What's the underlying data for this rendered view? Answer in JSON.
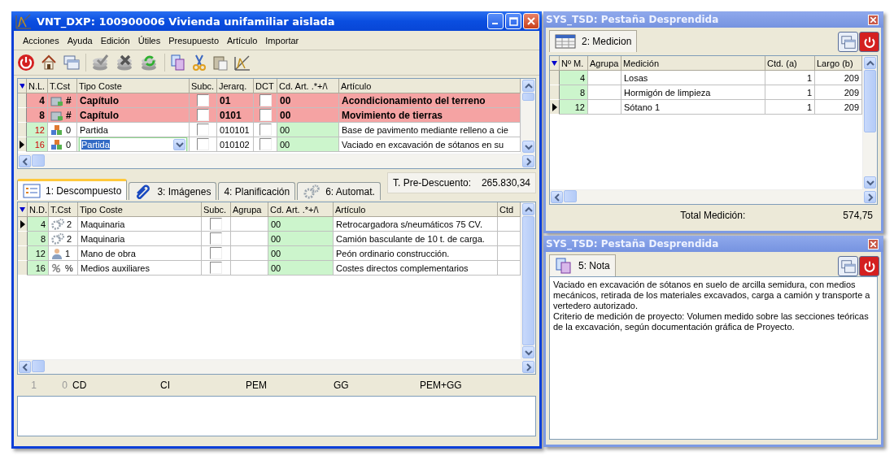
{
  "main_window": {
    "title": "VNT_DXP: 100900006 Vivienda unifamiliar aislada",
    "menu": [
      "Acciones",
      "Ayuda",
      "Edición",
      "Útiles",
      "Presupuesto",
      "Artículo",
      "Importar"
    ],
    "upper_grid": {
      "columns": [
        "N.L.",
        "T.Cst",
        "Tipo Coste",
        "Subc.",
        "Jerarq.",
        "DCT",
        "Cd. Art. .*+/\\",
        "Artículo"
      ],
      "rows": [
        {
          "kind": "chapter",
          "current": false,
          "editing": false,
          "nl": "4",
          "code": "#",
          "tipo": "Capítulo",
          "subc": false,
          "jerarq": "01",
          "dct": false,
          "cd": "00",
          "articulo": "Acondicionamiento del terreno"
        },
        {
          "kind": "chapter",
          "current": false,
          "editing": false,
          "nl": "8",
          "code": "#",
          "tipo": "Capítulo",
          "subc": false,
          "jerarq": "0101",
          "dct": false,
          "cd": "00",
          "articulo": "Movimiento de tierras"
        },
        {
          "kind": "item",
          "current": false,
          "editing": false,
          "nl": "12",
          "code": "0",
          "tipo": "Partida",
          "subc": false,
          "jerarq": "010101",
          "dct": false,
          "cd": "00",
          "articulo": "Base de pavimento mediante relleno a cie"
        },
        {
          "kind": "item",
          "current": true,
          "editing": true,
          "nl": "16",
          "code": "0",
          "tipo": "Partida",
          "subc": false,
          "jerarq": "010102",
          "dct": false,
          "cd": "00",
          "articulo": "Vaciado en excavación de sótanos en su"
        }
      ]
    },
    "tabs": [
      {
        "label": "1: Descompuesto",
        "selected": true
      },
      {
        "label": "3: Imágenes",
        "selected": false
      },
      {
        "label": "4: Planificación",
        "selected": false
      },
      {
        "label": "6: Automat.",
        "selected": false
      }
    ],
    "pre_descuento": {
      "label": "T. Pre-Descuento:",
      "value": "265.830,34"
    },
    "lower_grid": {
      "columns": [
        "N.D.",
        "T.Cst",
        "Tipo Coste",
        "Subc.",
        "Agrupa",
        "Cd. Art. .*+/\\",
        "Artículo",
        "Ctd"
      ],
      "rows": [
        {
          "kind": "machinery",
          "current": true,
          "nd": "4",
          "code": "2",
          "tipo": "Maquinaria",
          "subc": false,
          "cd": "00",
          "articulo": "Retrocargadora s/neumáticos 75 CV."
        },
        {
          "kind": "machinery",
          "current": false,
          "nd": "8",
          "code": "2",
          "tipo": "Maquinaria",
          "subc": false,
          "cd": "00",
          "articulo": "Camión basculante de 10 t. de carga."
        },
        {
          "kind": "labor",
          "current": false,
          "nd": "12",
          "code": "1",
          "tipo": "Mano de obra",
          "subc": false,
          "cd": "00",
          "articulo": "Peón ordinario construcción."
        },
        {
          "kind": "auxiliary",
          "current": false,
          "nd": "16",
          "code": "%",
          "tipo": "Medios auxiliares",
          "subc": false,
          "cd": "00",
          "articulo": "Costes directos complementarios"
        }
      ]
    },
    "summary": {
      "counts": [
        "1",
        "0"
      ],
      "labels": [
        "CD",
        "CI",
        "PEM",
        "GG",
        "PEM+GG"
      ]
    }
  },
  "medicion_panel": {
    "title": "SYS_TSD: Pestaña Desprendida",
    "tab": {
      "label": "2: Medicion",
      "selected": true
    },
    "columns": [
      "Nº M.",
      "Agrupa",
      "Medición",
      "Ctd. (a)",
      "Largo (b)"
    ],
    "rows": [
      {
        "current": false,
        "nm": "4",
        "medicion": "Losas",
        "ctd": "1",
        "largo": "209"
      },
      {
        "current": false,
        "nm": "8",
        "medicion": "Hormigón de limpieza",
        "ctd": "1",
        "largo": "209"
      },
      {
        "current": true,
        "nm": "12",
        "medicion": "Sótano 1",
        "ctd": "1",
        "largo": "209"
      }
    ],
    "total": {
      "label": "Total Medición:",
      "value": "574,75"
    }
  },
  "nota_panel": {
    "title": "SYS_TSD: Pestaña Desprendida",
    "tab": {
      "label": "5: Nota",
      "selected": true
    },
    "paragraphs": [
      "Vaciado en excavación de sótanos en suelo de arcilla semidura, con medios mecánicos, retirada de los materiales excavados, carga a camión y transporte a vertedero autorizado.",
      "Criterio de medición de proyecto: Volumen medido sobre las secciones teóricas de la excavación, según documentación gráfica de Proyecto."
    ]
  }
}
